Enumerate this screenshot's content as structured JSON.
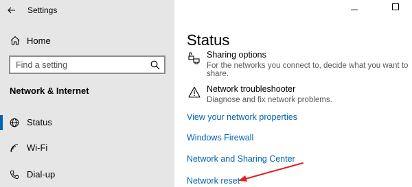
{
  "window": {
    "title": "Settings",
    "controls": {
      "minimize": "minimize-icon",
      "maximize": "maximize-icon"
    }
  },
  "sidebar": {
    "back_icon": "back-arrow-icon",
    "home": {
      "label": "Home",
      "icon": "home-icon"
    },
    "search": {
      "placeholder": "Find a setting",
      "icon": "search-icon"
    },
    "section_heading": "Network & Internet",
    "items": [
      {
        "label": "Status",
        "icon": "status-globe-icon",
        "active": true
      },
      {
        "label": "Wi-Fi",
        "icon": "wifi-icon",
        "active": false
      },
      {
        "label": "Dial-up",
        "icon": "dialup-icon",
        "active": false
      }
    ]
  },
  "main": {
    "title": "Status",
    "sharing": {
      "icon": "sharing-icon",
      "title": "Sharing options",
      "description": "For the networks you connect to, decide what you want to share."
    },
    "troubleshooter": {
      "icon": "warning-icon",
      "title": "Network troubleshooter",
      "description": "Diagnose and fix network problems."
    },
    "links": [
      "View your network properties",
      "Windows Firewall",
      "Network and Sharing Center",
      "Network reset"
    ]
  },
  "colors": {
    "accent": "#0063b1",
    "sidebar_bg": "#e6e6e6",
    "annotation_arrow": "#e0201e"
  }
}
